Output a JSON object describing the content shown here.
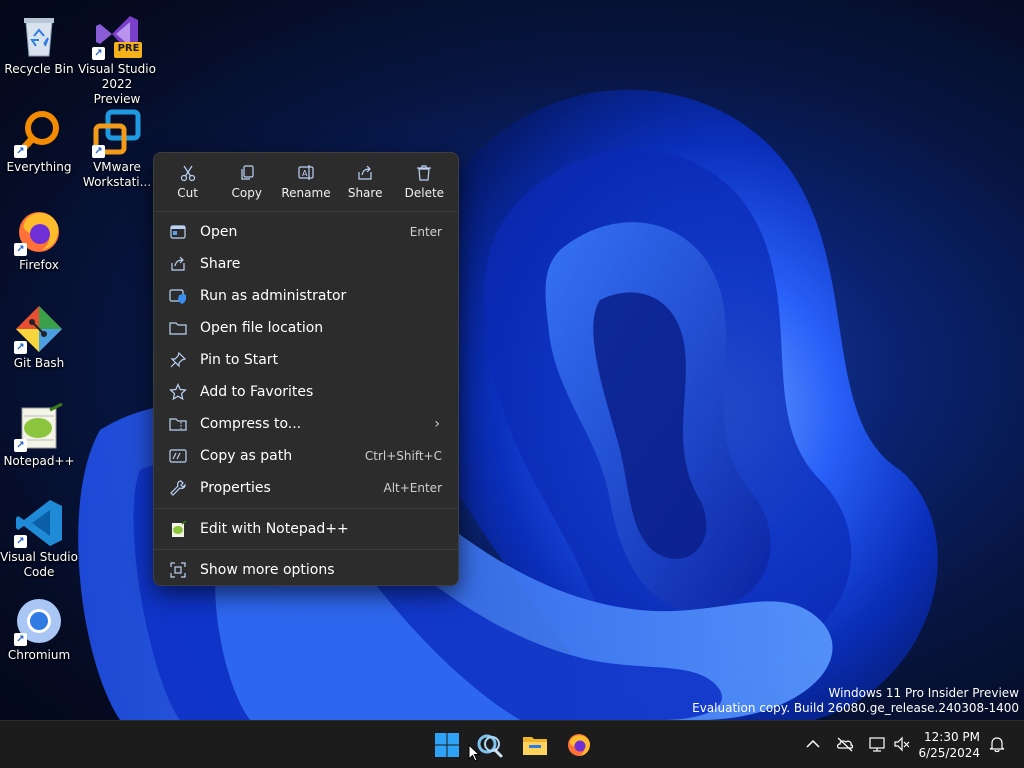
{
  "desktop_icons": [
    {
      "label": "Recycle Bin",
      "icon": "recycle-bin-icon",
      "shortcut": false
    },
    {
      "label": "Visual Studio\n2022 Preview",
      "icon": "visual-studio-preview-icon",
      "shortcut": true,
      "badge": "PRE"
    },
    {
      "label": "Everything",
      "icon": "everything-search-icon",
      "shortcut": true
    },
    {
      "label": "VMware\nWorkstati...",
      "icon": "vmware-icon",
      "shortcut": true
    },
    {
      "label": "Firefox",
      "icon": "firefox-icon",
      "shortcut": true
    },
    {
      "label": "Git Bash",
      "icon": "git-bash-icon",
      "shortcut": true
    },
    {
      "label": "Notepad++",
      "icon": "notepadpp-icon",
      "shortcut": true
    },
    {
      "label": "Visual Studio\nCode",
      "icon": "vscode-icon",
      "shortcut": true
    },
    {
      "label": "Chromium",
      "icon": "chromium-icon",
      "shortcut": true
    }
  ],
  "shortcut_arrow": "↗",
  "context_menu": {
    "quick_actions": [
      {
        "label": "Cut",
        "icon": "scissors-icon"
      },
      {
        "label": "Copy",
        "icon": "copy-icon"
      },
      {
        "label": "Rename",
        "icon": "rename-icon"
      },
      {
        "label": "Share",
        "icon": "share-icon"
      },
      {
        "label": "Delete",
        "icon": "trash-icon"
      }
    ],
    "items": [
      {
        "label": "Open",
        "shortcut": "Enter",
        "icon": "open-app-icon"
      },
      {
        "label": "Share",
        "shortcut": "",
        "icon": "share-icon"
      },
      {
        "label": "Run as administrator",
        "shortcut": "",
        "icon": "shield-icon"
      },
      {
        "label": "Open file location",
        "shortcut": "",
        "icon": "folder-icon"
      },
      {
        "label": "Pin to Start",
        "shortcut": "",
        "icon": "pin-icon"
      },
      {
        "label": "Add to Favorites",
        "shortcut": "",
        "icon": "star-icon"
      },
      {
        "label": "Compress to...",
        "shortcut": "",
        "icon": "archive-icon",
        "submenu": true
      },
      {
        "label": "Copy as path",
        "shortcut": "Ctrl+Shift+C",
        "icon": "path-icon"
      },
      {
        "label": "Properties",
        "shortcut": "Alt+Enter",
        "icon": "wrench-icon"
      }
    ],
    "extra_items": [
      {
        "label": "Edit with Notepad++",
        "icon": "notepadpp-icon"
      },
      {
        "label": "Show more options",
        "icon": "more-options-icon"
      }
    ],
    "submenu_chevron": "›"
  },
  "watermark": {
    "line1": "Windows 11 Pro Insider Preview",
    "line2": "Evaluation copy. Build 26080.ge_release.240308-1400"
  },
  "taskbar": {
    "apps": [
      "start-icon",
      "search-app-icon",
      "file-explorer-icon",
      "firefox-icon"
    ],
    "tray": [
      "chevron-up-icon",
      "onedrive-offline-icon",
      "network-icon",
      "volume-muted-icon",
      "notification-bell-icon"
    ],
    "time": "12:30 PM",
    "date": "6/25/2024"
  },
  "colors": {
    "menu_bg": "#2c2c2c",
    "taskbar_bg": "#1c1c1c",
    "accent": "#0a84ff"
  }
}
